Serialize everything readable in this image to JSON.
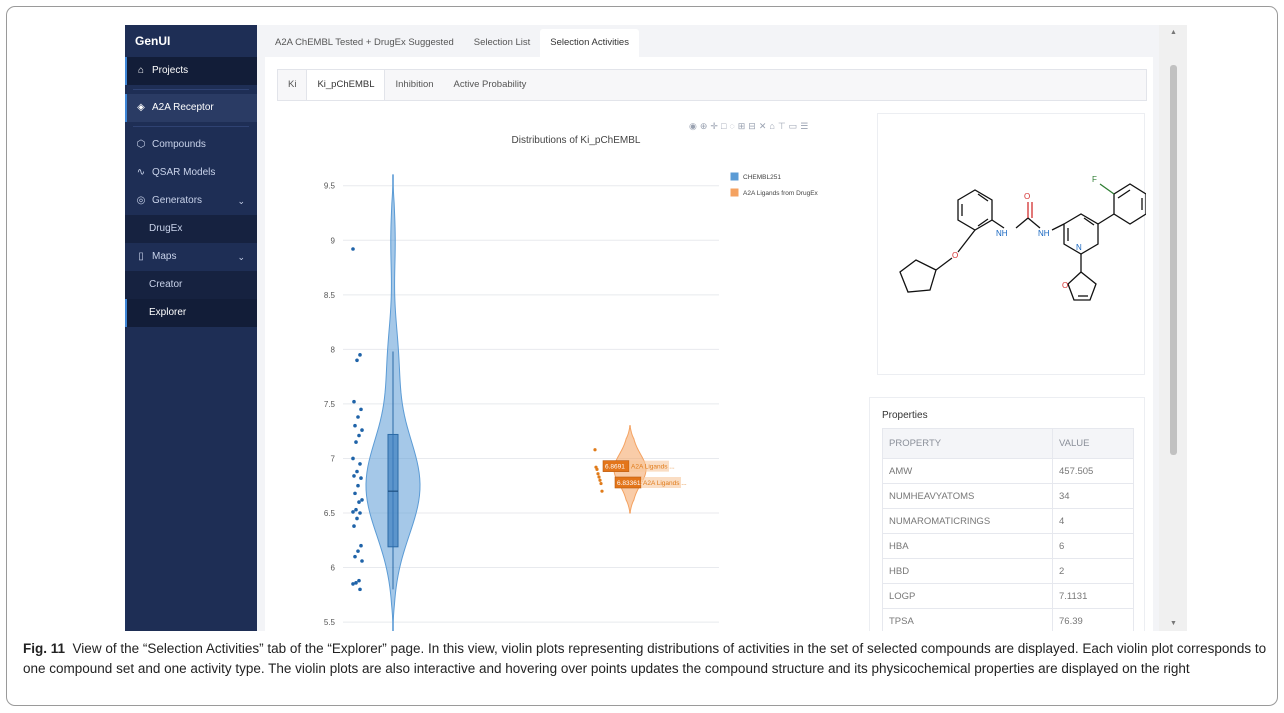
{
  "sidebar": {
    "brand": "GenUI",
    "items": [
      {
        "label": "Projects",
        "icon": "home-icon"
      },
      {
        "label": "A2A Receptor",
        "icon": "layers-icon"
      },
      {
        "label": "Compounds",
        "icon": "cube-icon"
      },
      {
        "label": "QSAR Models",
        "icon": "pulse-icon"
      },
      {
        "label": "Generators",
        "icon": "compass-icon"
      },
      {
        "label": "DrugEx"
      },
      {
        "label": "Maps",
        "icon": "map-icon"
      },
      {
        "label": "Creator"
      },
      {
        "label": "Explorer"
      }
    ]
  },
  "tabs": {
    "top": [
      "A2A ChEMBL Tested + DrugEx Suggested",
      "Selection List",
      "Selection Activities"
    ],
    "top_active": "Selection Activities",
    "inner": [
      "Ki",
      "Ki_pChEMBL",
      "Inhibition",
      "Active Probability"
    ],
    "inner_active": "Ki_pChEMBL"
  },
  "chart_data": {
    "type": "violin",
    "title": "Distributions of Ki_pChEMBL",
    "xlabel": "",
    "ylabel": "",
    "ylim": [
      5.4,
      9.8
    ],
    "yticks": [
      5.5,
      6,
      6.5,
      7,
      7.5,
      8,
      8.5,
      9,
      9.5
    ],
    "grid": true,
    "legend_position": "top-right",
    "series": [
      {
        "name": "CHEMBL251",
        "color": "#5b9bd5",
        "kde_max_y": 9.6,
        "kde_min_y": 5.4,
        "box": {
          "q1": 6.19,
          "median": 6.7,
          "q3": 7.22,
          "whisker_low": 5.8,
          "whisker_high": 7.98
        },
        "points": [
          8.92,
          7.95,
          7.9,
          7.52,
          7.45,
          7.38,
          7.3,
          7.26,
          7.21,
          7.15,
          7.0,
          6.95,
          6.88,
          6.84,
          6.82,
          6.75,
          6.68,
          6.62,
          6.6,
          6.53,
          6.51,
          6.5,
          6.45,
          6.38,
          6.2,
          6.15,
          6.1,
          6.06,
          5.88,
          5.86,
          5.85,
          5.8
        ]
      },
      {
        "name": "A2A Ligands from DrugEx",
        "color": "#f4a261",
        "kde_max_y": 7.3,
        "kde_min_y": 6.5,
        "points": [
          7.08,
          6.92,
          6.9,
          6.86,
          6.83,
          6.8,
          6.77,
          6.7
        ]
      }
    ],
    "hover_labels": [
      {
        "value": "6.8691",
        "text": "A2A Ligands ..."
      },
      {
        "value": "6.833615",
        "text": "A2A Ligands ..."
      }
    ]
  },
  "molecule": {
    "atom_labels": [
      "NH",
      "O",
      "NH",
      "O",
      "N",
      "F",
      "O"
    ]
  },
  "properties": {
    "title": "Properties",
    "headers": [
      "PROPERTY",
      "VALUE"
    ],
    "rows": [
      [
        "AMW",
        "457.505"
      ],
      [
        "NUMHEAVYATOMS",
        "34"
      ],
      [
        "NUMAROMATICRINGS",
        "4"
      ],
      [
        "HBA",
        "6"
      ],
      [
        "HBD",
        "2"
      ],
      [
        "LOGP",
        "7.1131"
      ],
      [
        "TPSA",
        "76.39"
      ]
    ]
  },
  "caption": {
    "label": "Fig. 11",
    "text": "View of the “Selection Activities” tab of the “Explorer” page. In this view, violin plots representing distributions of activities in the set of selected compounds are displayed. Each violin plot corresponds to one compound set and one activity type. The violin plots are also interactive and hovering over points updates the compound structure and its physicochemical properties are displayed on the right"
  },
  "colors": {
    "sidebar": "#1e2e55",
    "accent": "#3e85d6",
    "series1": "#5b9bd5",
    "series2": "#f4a261"
  }
}
